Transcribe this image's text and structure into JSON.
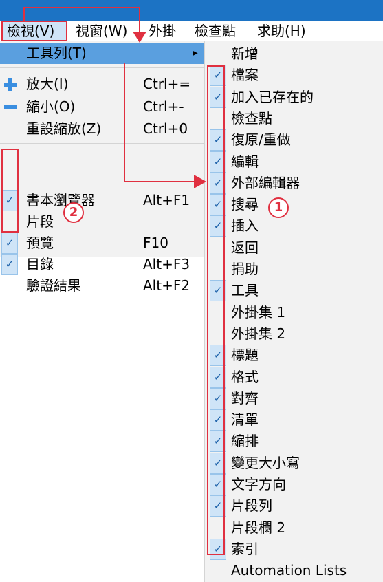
{
  "menubar": {
    "items": [
      "檢視(V)",
      "視窗(W)",
      "外掛",
      "檢查點",
      "求助(H)"
    ]
  },
  "view_menu": {
    "toolbar_item": "工具列(T)",
    "zoom_in": {
      "label": "放大(I)",
      "shortcut": "Ctrl+="
    },
    "zoom_out": {
      "label": "縮小(O)",
      "shortcut": "Ctrl+-"
    },
    "reset_zoom": {
      "label": "重設縮放(Z)",
      "shortcut": "Ctrl+0"
    },
    "panels": [
      {
        "label": "書本瀏覽器",
        "shortcut": "Alt+F1",
        "checked": true
      },
      {
        "label": "片段",
        "shortcut": "",
        "checked": false
      },
      {
        "label": "預覽",
        "shortcut": "F10",
        "checked": true
      },
      {
        "label": "目錄",
        "shortcut": "Alt+F3",
        "checked": true
      },
      {
        "label": "驗證結果",
        "shortcut": "Alt+F2",
        "checked": false
      }
    ]
  },
  "toolbar_submenu": {
    "items": [
      {
        "label": "新增",
        "checked": false
      },
      {
        "label": "檔案",
        "checked": true
      },
      {
        "label": "加入已存在的",
        "checked": true
      },
      {
        "label": "檢查點",
        "checked": false
      },
      {
        "label": "復原/重做",
        "checked": true
      },
      {
        "label": "編輯",
        "checked": true
      },
      {
        "label": "外部編輯器",
        "checked": true
      },
      {
        "label": "搜尋",
        "checked": true
      },
      {
        "label": "插入",
        "checked": true
      },
      {
        "label": "返回",
        "checked": false
      },
      {
        "label": "捐助",
        "checked": false
      },
      {
        "label": "工具",
        "checked": true
      },
      {
        "label": "外掛集 1",
        "checked": false
      },
      {
        "label": "外掛集 2",
        "checked": false
      },
      {
        "label": "標題",
        "checked": true
      },
      {
        "label": "格式",
        "checked": true
      },
      {
        "label": "對齊",
        "checked": true
      },
      {
        "label": "清單",
        "checked": true
      },
      {
        "label": "縮排",
        "checked": true
      },
      {
        "label": "變更大小寫",
        "checked": true
      },
      {
        "label": "文字方向",
        "checked": true
      },
      {
        "label": "片段列",
        "checked": true
      },
      {
        "label": "片段欄 2",
        "checked": false
      },
      {
        "label": "索引",
        "checked": true
      },
      {
        "label": "Automation Lists",
        "checked": false
      }
    ]
  },
  "annotations": {
    "badge_1": "1",
    "badge_2": "2"
  },
  "icons": {
    "check": "checkmark-icon",
    "zoom_in": "plus-icon",
    "zoom_out": "minus-icon",
    "submenu": "submenu-arrow-icon"
  },
  "colors": {
    "titlebar": "#1c73c4",
    "highlight": "#5a9fdf",
    "check_bg": "#cfe4f7",
    "annotation": "#e03040"
  }
}
